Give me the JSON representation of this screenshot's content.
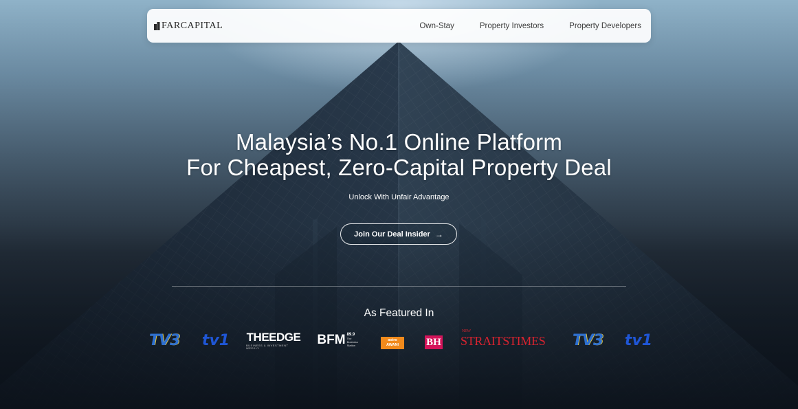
{
  "brand": {
    "name": "FARCAPITAL"
  },
  "nav": {
    "links": [
      "Own-Stay",
      "Property Investors",
      "Property Developers"
    ]
  },
  "hero": {
    "headline_line1": "Malaysia’s No.1 Online Platform",
    "headline_line2": "For Cheapest, Zero-Capital Property Deal",
    "subheadline": "Unlock With Unfair Advantage",
    "cta_label": "Join Our Deal Insider",
    "cta_icon": "arrow-right-icon"
  },
  "featured": {
    "title": "As Featured In",
    "logos": [
      {
        "name": "TV3",
        "text": "TV3"
      },
      {
        "name": "TV1",
        "text": "tv1"
      },
      {
        "name": "The Edge",
        "text": "THEEDGE",
        "tagline": "BUSINESS & INVESTMENT WEEKLY"
      },
      {
        "name": "BFM",
        "text": "BFM",
        "frequency": "89.9",
        "tagline": "The Business Station"
      },
      {
        "name": "Astro Awani",
        "text": "astro AWANI"
      },
      {
        "name": "Berita Harian",
        "text": "BH"
      },
      {
        "name": "New Straits Times",
        "prefix": "NEW",
        "text": "STRAITSTIMES"
      },
      {
        "name": "TV3",
        "text": "TV3"
      },
      {
        "name": "TV1",
        "text": "tv1"
      }
    ]
  },
  "colors": {
    "navbar_bg": "#ffffff",
    "headline_text": "#ffffff",
    "nst_red": "#d8232f",
    "tv1_blue": "#1f56d6",
    "astro_orange": "#f18a1c",
    "bh_pink": "#d4145a"
  }
}
